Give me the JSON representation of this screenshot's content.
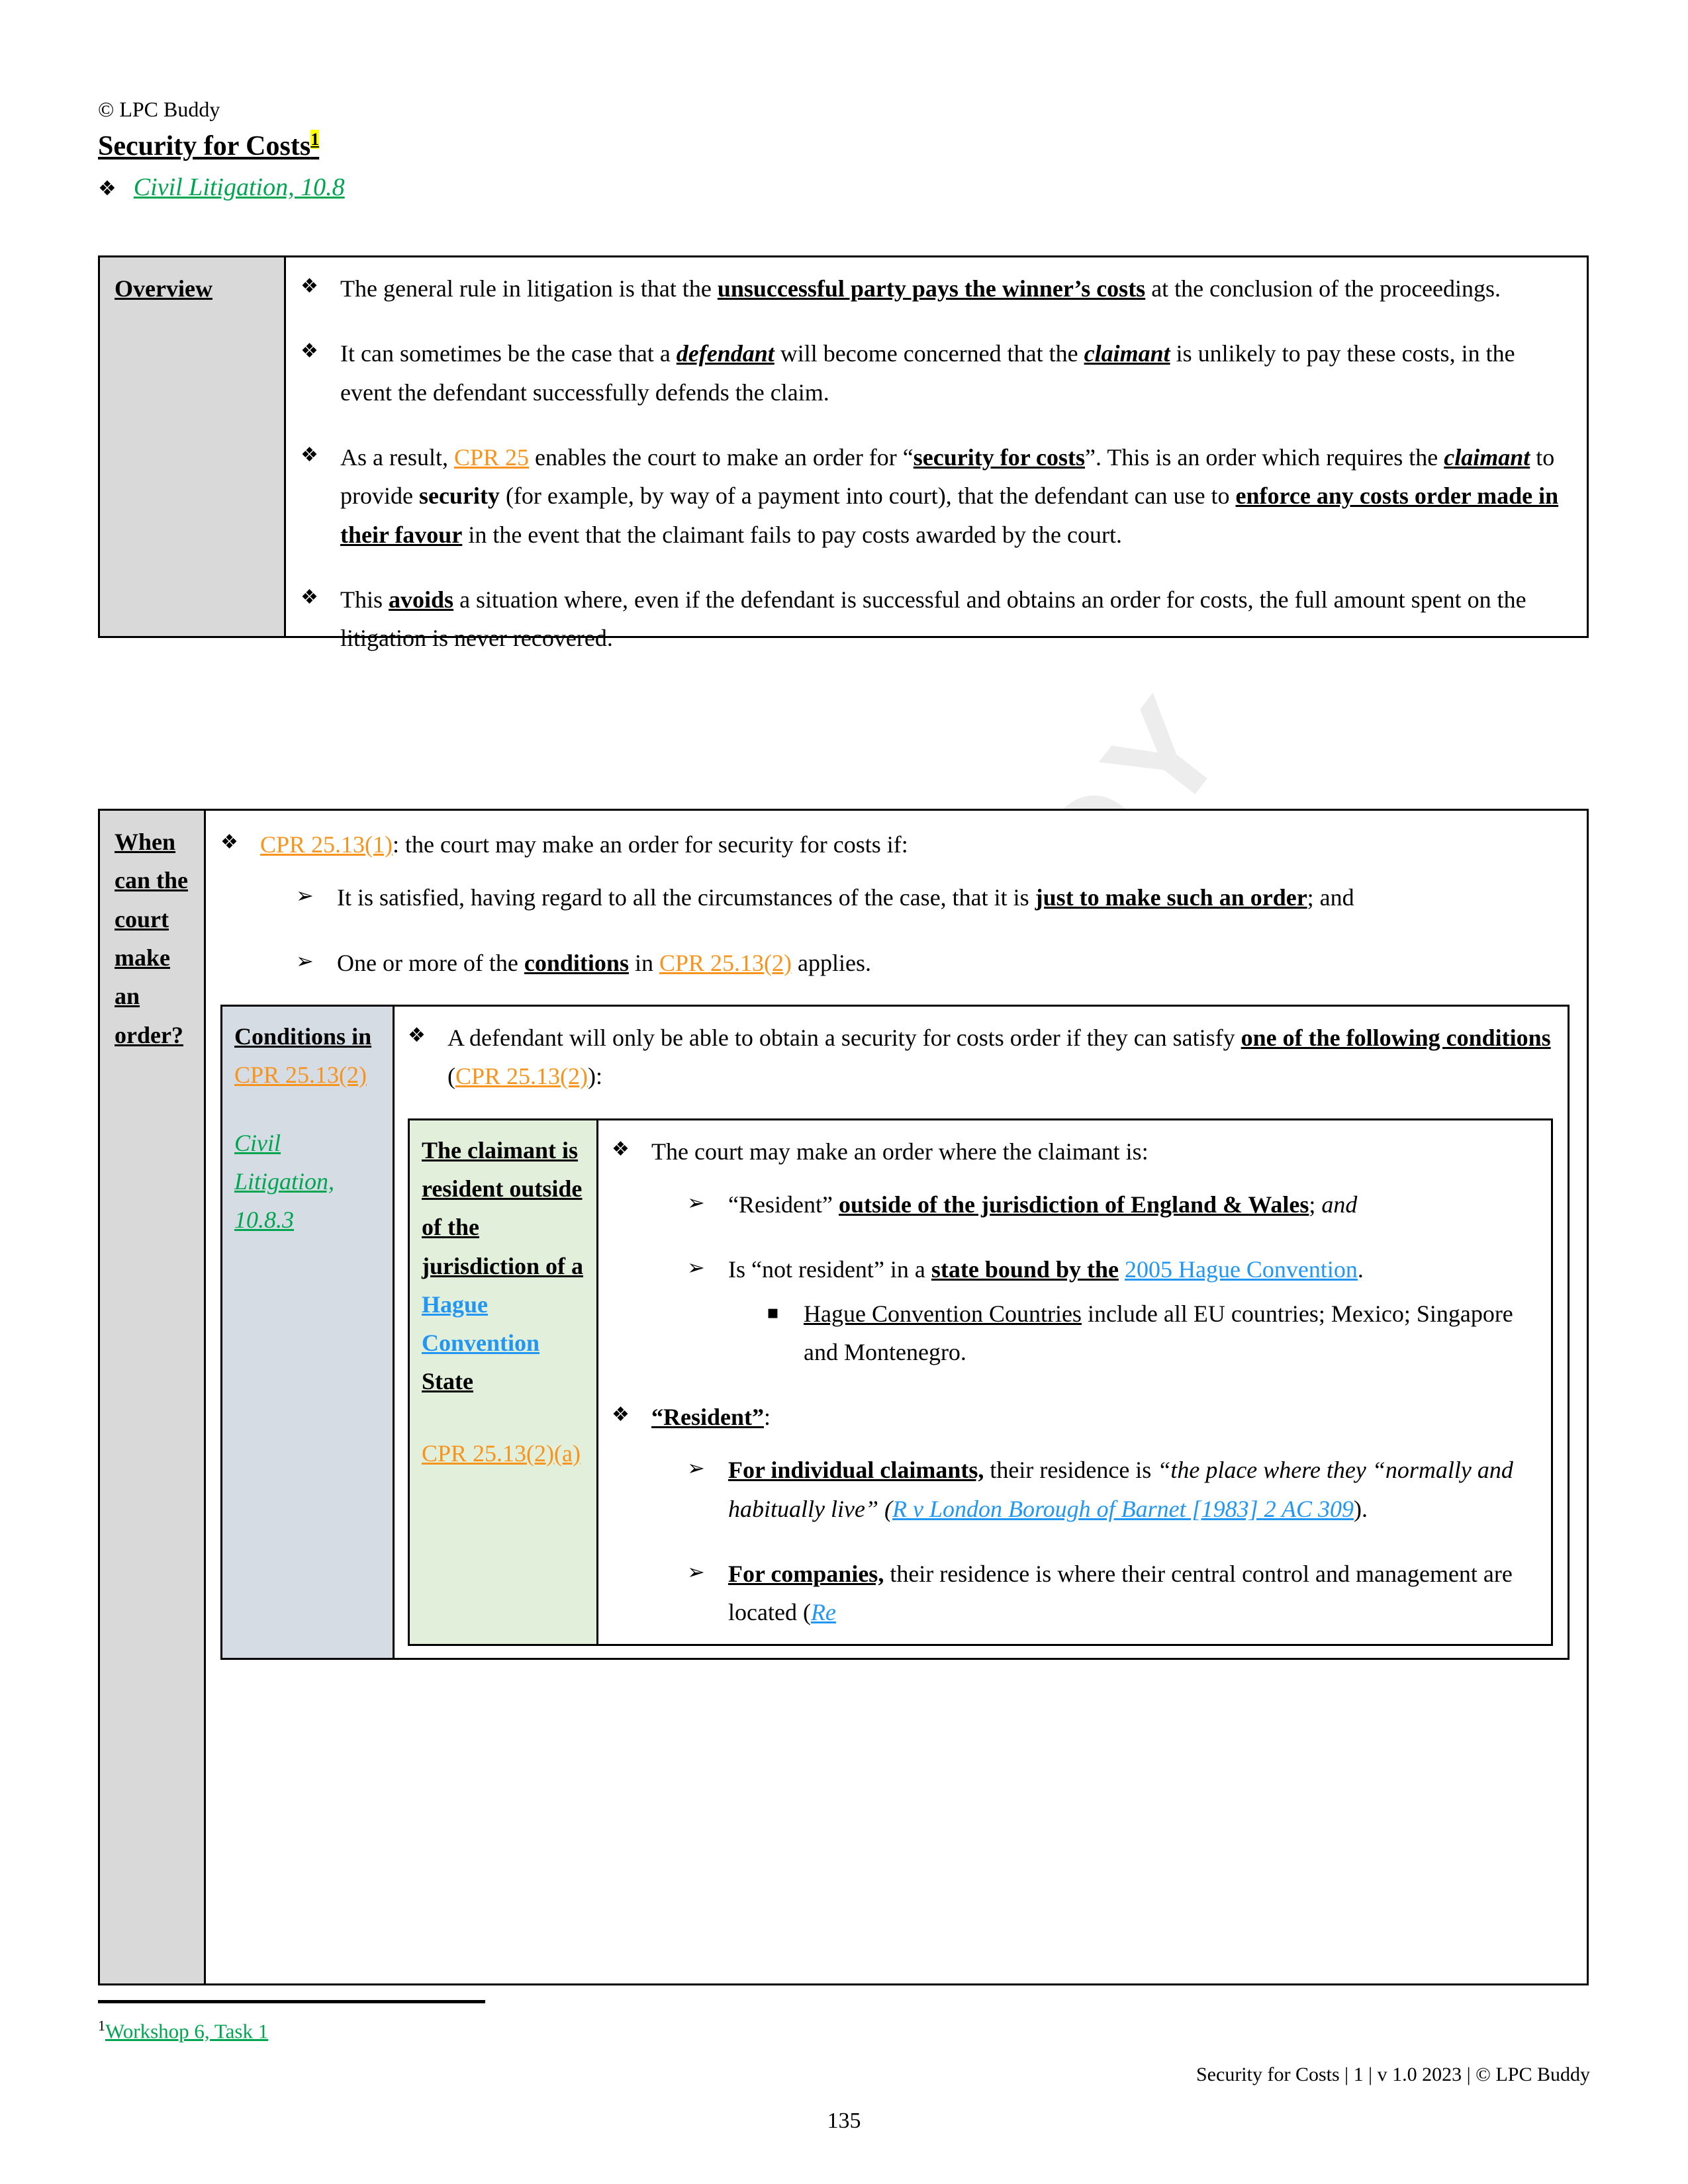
{
  "header": {
    "copyright": "© LPC Buddy",
    "title": "Security for Costs",
    "footnote_marker": "1",
    "reference_bullet": "❖",
    "reference_link": "Civil Litigation, 10.8"
  },
  "icons": {
    "diamond_bullet": "❖",
    "arrow_bullet": "➢",
    "square_bullet": "▪"
  },
  "colors": {
    "link_green": "#00a550",
    "link_orange": "#f7941d",
    "link_blue": "#2196f3",
    "highlight_yellow": "#ffff00",
    "cell_grey": "#d9d9d9",
    "cell_blue": "#d6dce4",
    "cell_green": "#e2efda",
    "watermark": "#ededed"
  },
  "watermark": "LPC BUDDY",
  "overview": {
    "label": "Overview",
    "bullets": [
      {
        "parts": [
          {
            "t": "The general rule in litigation is that the ",
            "s": "n"
          },
          {
            "t": "unsuccessful party pays the winner’s costs",
            "s": "bu"
          },
          {
            "t": " at the conclusion of the proceedings.",
            "s": "n"
          }
        ]
      },
      {
        "parts": [
          {
            "t": "It can sometimes be the case that a ",
            "s": "n"
          },
          {
            "t": "defendant",
            "s": "biu"
          },
          {
            "t": " will become concerned that the ",
            "s": "n"
          },
          {
            "t": "claimant",
            "s": "biu"
          },
          {
            "t": " is unlikely to pay these costs, in the event the defendant successfully defends the claim.",
            "s": "n"
          }
        ]
      },
      {
        "parts": [
          {
            "t": "As a result, ",
            "s": "n"
          },
          {
            "t": "CPR 25",
            "s": "orange"
          },
          {
            "t": " enables the court to make an order for “",
            "s": "n"
          },
          {
            "t": "security for costs",
            "s": "bu"
          },
          {
            "t": "”. This is an order which requires the ",
            "s": "n"
          },
          {
            "t": "claimant",
            "s": "biu"
          },
          {
            "t": " to provide ",
            "s": "n"
          },
          {
            "t": "security",
            "s": "b"
          },
          {
            "t": " (for example, by way of a payment into court), that the defendant can use to ",
            "s": "n"
          },
          {
            "t": "enforce any costs order made in their favour",
            "s": "bu"
          },
          {
            "t": " in the event that the claimant fails to pay costs awarded by the court.",
            "s": "n"
          }
        ]
      },
      {
        "parts": [
          {
            "t": "This ",
            "s": "n"
          },
          {
            "t": "avoids",
            "s": "bu"
          },
          {
            "t": " a situation where, even if the defendant is successful and obtains an order for costs, the full amount spent on the litigation is never recovered.",
            "s": "n"
          }
        ]
      }
    ]
  },
  "when_can_court": {
    "label": "When can the court make an order?",
    "lead": {
      "parts": [
        {
          "t": "CPR 25.13(1)",
          "s": "orange"
        },
        {
          "t": ": the court may make an order for security for costs if:",
          "s": "n"
        }
      ]
    },
    "sub_bullets": [
      {
        "parts": [
          {
            "t": "It is satisfied, having regard to all the circumstances of the case, that it is ",
            "s": "n"
          },
          {
            "t": "just to make such an order",
            "s": "bu"
          },
          {
            "t": "; and",
            "s": "n"
          }
        ]
      },
      {
        "parts": [
          {
            "t": "One or more of the ",
            "s": "n"
          },
          {
            "t": "conditions",
            "s": "bu"
          },
          {
            "t": " in ",
            "s": "n"
          },
          {
            "t": "CPR 25.13(2)",
            "s": "orange"
          },
          {
            "t": " applies.",
            "s": "n"
          }
        ]
      }
    ],
    "conditions_table": {
      "label_heading": "Conditions in",
      "label_cpr": "CPR 25.13(2)",
      "label_civlit": "Civil Litigation, 10.8.3",
      "lead": {
        "parts": [
          {
            "t": "A defendant will only be able to obtain a security for costs order if they can satisfy ",
            "s": "n"
          },
          {
            "t": "one of the following conditions",
            "s": "bu"
          },
          {
            "t": " (",
            "s": "n"
          },
          {
            "t": "CPR 25.13(2)",
            "s": "orange"
          },
          {
            "t": "):",
            "s": "n"
          }
        ]
      },
      "condition": {
        "heading_parts": [
          {
            "t": "The claimant is resident outside of the jurisdiction of a ",
            "s": "bu"
          },
          {
            "t": "Hague Convention",
            "s": "blue"
          },
          {
            "t": " State",
            "s": "bu"
          }
        ],
        "cpr": "CPR 25.13(2)(a)",
        "bullets": [
          {
            "level": 1,
            "parts": [
              {
                "t": "The court may make an order where the claimant is:",
                "s": "n"
              }
            ]
          },
          {
            "level": 2,
            "parts": [
              {
                "t": "“Resident” ",
                "s": "n"
              },
              {
                "t": "outside of the jurisdiction of England & Wales",
                "s": "bu"
              },
              {
                "t": "; ",
                "s": "n"
              },
              {
                "t": "and",
                "s": "i"
              }
            ]
          },
          {
            "level": 2,
            "parts": [
              {
                "t": "Is “not resident” in a ",
                "s": "n"
              },
              {
                "t": "state bound by the",
                "s": "bu"
              },
              {
                "t": " ",
                "s": "n"
              },
              {
                "t": "2005 Hague Convention",
                "s": "blue"
              },
              {
                "t": ".",
                "s": "n"
              }
            ]
          },
          {
            "level": 3,
            "parts": [
              {
                "t": "Hague Convention Countries",
                "s": "u"
              },
              {
                "t": " include all EU countries; Mexico; Singapore and Montenegro.",
                "s": "n"
              }
            ]
          },
          {
            "level": 1,
            "parts": [
              {
                "t": "“Resident”",
                "s": "bu"
              },
              {
                "t": ":",
                "s": "n"
              }
            ]
          },
          {
            "level": 2,
            "parts": [
              {
                "t": "For individual claimants,",
                "s": "bu"
              },
              {
                "t": " their residence is ",
                "s": "n"
              },
              {
                "t": "“the place where they “normally and habitually live” (",
                "s": "i"
              },
              {
                "t": "R v London Borough of Barnet [1983] 2 AC 309",
                "s": "blueitalic"
              },
              {
                "t": ").",
                "s": "n"
              }
            ]
          },
          {
            "level": 2,
            "parts": [
              {
                "t": "For companies,",
                "s": "bu"
              },
              {
                "t": " their residence is where their central control and management are located (",
                "s": "n"
              },
              {
                "t": "Re",
                "s": "blueitalic"
              }
            ]
          }
        ]
      }
    }
  },
  "footnote": {
    "marker": "1",
    "text": "Workshop 6, Task 1"
  },
  "footer": {
    "right": "Security for Costs | 1 | v 1.0 2023 | © LPC Buddy",
    "page_number": "135"
  }
}
